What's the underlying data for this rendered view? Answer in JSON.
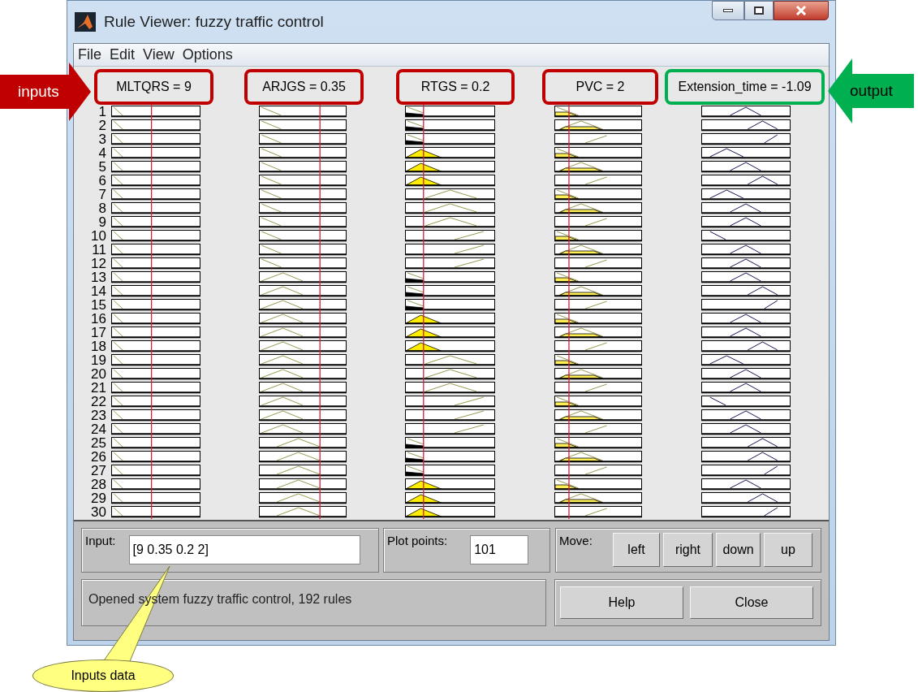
{
  "window": {
    "title": "Rule Viewer: fuzzy traffic control"
  },
  "menu": [
    "File",
    "Edit",
    "View",
    "Options"
  ],
  "variables": [
    {
      "label": "MLTQRS = 9",
      "kind": "input"
    },
    {
      "label": "ARJGS = 0.35",
      "kind": "input"
    },
    {
      "label": "RTGS = 0.2",
      "kind": "input"
    },
    {
      "label": "PVC = 2",
      "kind": "input"
    },
    {
      "label": "Extension_time = -1.09",
      "kind": "output"
    }
  ],
  "rule_numbers": [
    "1",
    "2",
    "3",
    "4",
    "5",
    "6",
    "7",
    "8",
    "9",
    "10",
    "11",
    "12",
    "13",
    "14",
    "15",
    "16",
    "17",
    "18",
    "19",
    "20",
    "21",
    "22",
    "23",
    "24",
    "25",
    "26",
    "27",
    "28",
    "29",
    "30"
  ],
  "input": {
    "label": "Input:",
    "value": "[9 0.35 0.2 2]"
  },
  "plot_points": {
    "label": "Plot points:",
    "value": "101"
  },
  "move": {
    "label": "Move:",
    "buttons": [
      "left",
      "right",
      "down",
      "up"
    ]
  },
  "status": "Opened system fuzzy traffic control, 192 rules",
  "buttons": [
    "Help",
    "Close"
  ],
  "annotations": [
    {
      "kind": "inputs-arrow",
      "text": "inputs"
    },
    {
      "kind": "output-arrow",
      "text": "output"
    },
    {
      "kind": "callout",
      "text": "Inputs data"
    }
  ]
}
